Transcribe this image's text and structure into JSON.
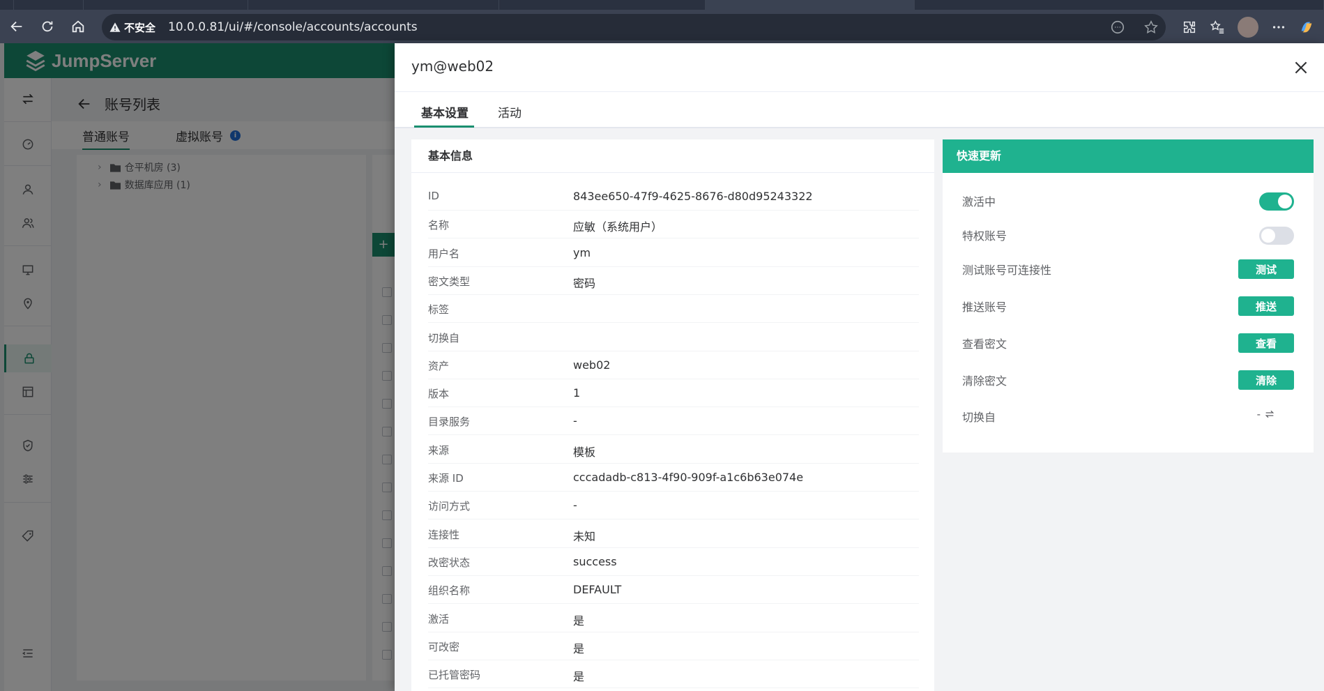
{
  "browser": {
    "security_label": "不安全",
    "url": "10.0.0.81/ui/#/console/accounts/accounts"
  },
  "app": {
    "brand": "JumpServer",
    "page_title": "账号列表",
    "tabs": [
      {
        "label": "普通账号",
        "active": true
      },
      {
        "label": "虚拟账号",
        "active": false,
        "info_mark": "i"
      }
    ],
    "tree": [
      {
        "label": "仓平机房 (3)"
      },
      {
        "label": "数据库应用 (1)"
      }
    ],
    "add_button": "+"
  },
  "drawer": {
    "title": "ym@web02",
    "tabs": [
      {
        "label": "基本设置",
        "active": true
      },
      {
        "label": "活动",
        "active": false
      }
    ],
    "basic_info": {
      "title": "基本信息",
      "rows": [
        {
          "key": "ID",
          "value": "843ee650-47f9-4625-8676-d80d95243322"
        },
        {
          "key": "名称",
          "value": "应敏（系统用户）"
        },
        {
          "key": "用户名",
          "value": "ym"
        },
        {
          "key": "密文类型",
          "value": "密码"
        },
        {
          "key": "标签",
          "value": ""
        },
        {
          "key": "切换自",
          "value": ""
        },
        {
          "key": "资产",
          "value": "web02"
        },
        {
          "key": "版本",
          "value": "1"
        },
        {
          "key": "目录服务",
          "value": "-"
        },
        {
          "key": "来源",
          "value": "模板"
        },
        {
          "key": "来源 ID",
          "value": "cccadadb-c813-4f90-909f-a1c6b63e074e"
        },
        {
          "key": "访问方式",
          "value": "-"
        },
        {
          "key": "连接性",
          "value": "未知"
        },
        {
          "key": "改密状态",
          "value": "success"
        },
        {
          "key": "组织名称",
          "value": "DEFAULT"
        },
        {
          "key": "激活",
          "value": "是"
        },
        {
          "key": "可改密",
          "value": "是"
        },
        {
          "key": "已托管密码",
          "value": "是"
        }
      ]
    },
    "quick_update": {
      "title": "快速更新",
      "active_label": "激活中",
      "active_on": true,
      "privileged_label": "特权账号",
      "privileged_on": false,
      "test_label": "测试账号可连接性",
      "test_button": "测试",
      "push_label": "推送账号",
      "push_button": "推送",
      "view_label": "查看密文",
      "view_button": "查看",
      "clear_label": "清除密文",
      "clear_button": "清除",
      "switch_label": "切换自",
      "switch_value": "-"
    },
    "colors": {
      "accent": "#1fb28f",
      "brand_header": "#1a8f6f"
    }
  }
}
